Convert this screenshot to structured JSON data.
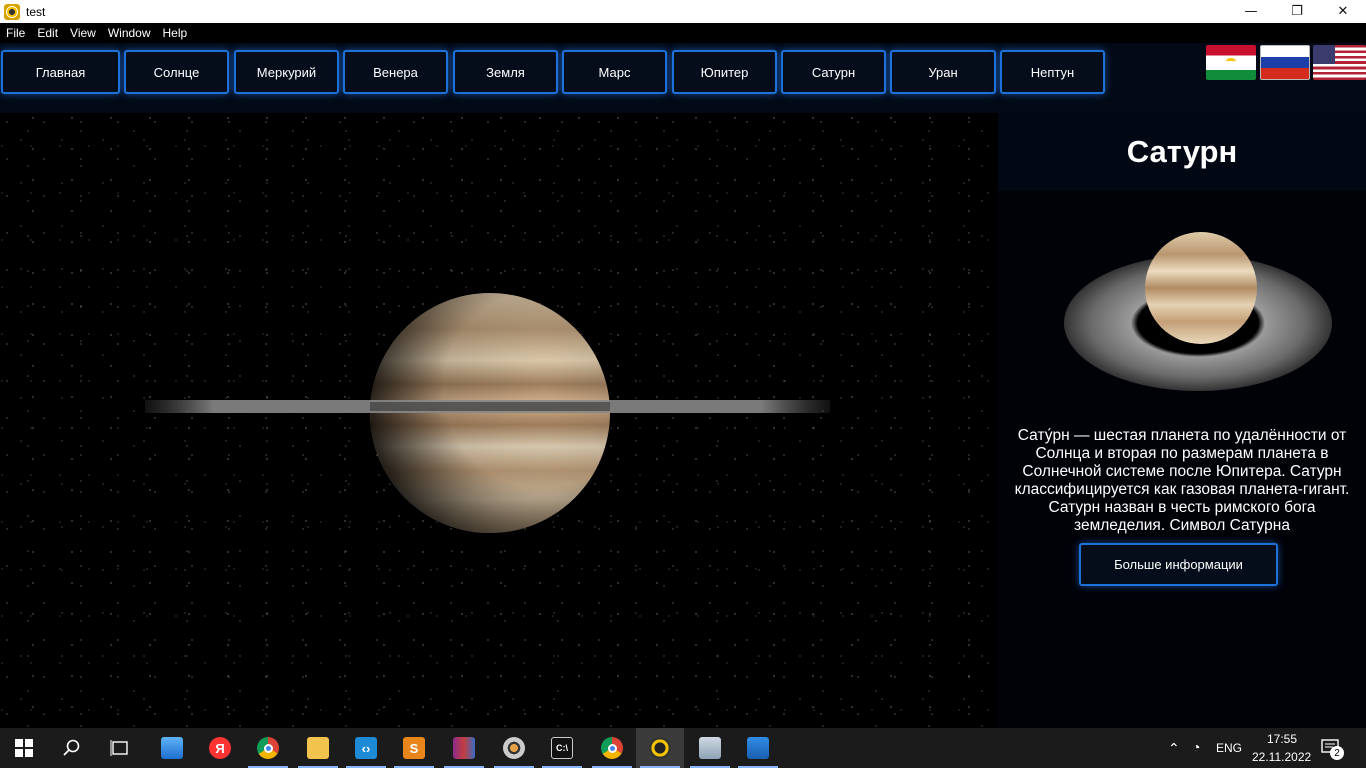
{
  "window": {
    "title": "test",
    "controls": {
      "minimize": "—",
      "maximize": "❐",
      "close": "✕"
    }
  },
  "menu": [
    "File",
    "Edit",
    "View",
    "Window",
    "Help"
  ],
  "nav": {
    "items": [
      "Главная",
      "Солнце",
      "Меркурий",
      "Венера",
      "Земля",
      "Марс",
      "Юпитер",
      "Сатурн",
      "Уран",
      "Нептун"
    ]
  },
  "flags": [
    "tajikistan-flag-icon",
    "russia-flag-icon",
    "usa-flag-icon"
  ],
  "panel": {
    "title": "Сатурн",
    "description": "Сату́рн — шестая планета по удалённости от Солнца и вторая по размерам планета в Солнечной системе после Юпитера. Сатурн классифицируется как газовая планета-гигант. Сатурн назван в честь римского бога земледелия. Символ Сатурна",
    "more_button": "Больше информации"
  },
  "taskbar": {
    "apps": [
      "windows-start-icon",
      "search-icon",
      "task-view-icon",
      "desktop-app-icon",
      "yandex-icon",
      "chrome-icon",
      "file-explorer-icon",
      "vscode-icon",
      "sublime-icon",
      "winrar-icon",
      "disc-app-icon",
      "terminal-icon",
      "chrome-profile-icon",
      "planet-app-icon",
      "monitor-app-icon",
      "photos-icon"
    ],
    "language": "ENG",
    "time": "17:55",
    "date": "22.11.2022",
    "notifications": "2"
  },
  "colors": {
    "accent": "#1c72d8",
    "background": "#000000",
    "panel": "#020714"
  }
}
